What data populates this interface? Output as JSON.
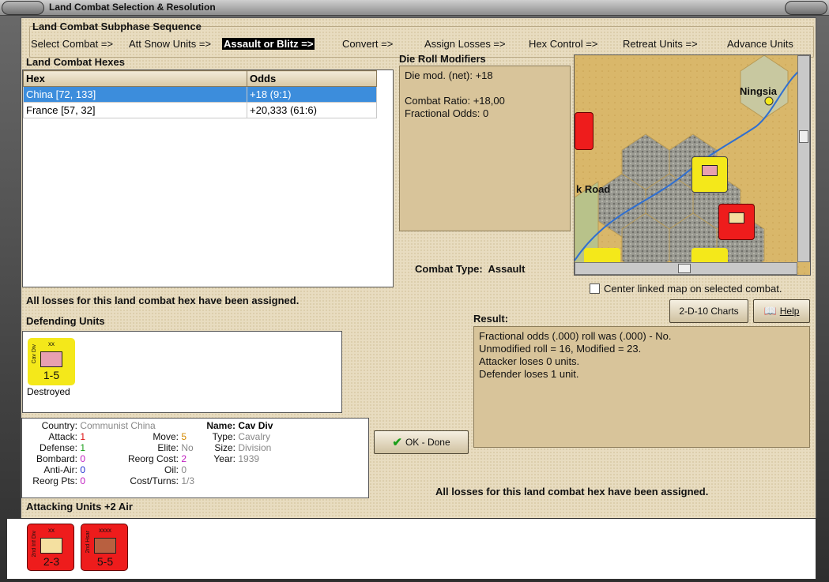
{
  "window": {
    "title": "Land Combat Selection & Resolution"
  },
  "sequence": {
    "heading": "Land Combat Subphase Sequence",
    "steps": [
      "Select Combat =>",
      "Att Snow Units =>",
      "Assault or Blitz =>",
      "Convert =>",
      "Assign Losses =>",
      "Hex Control =>",
      "Retreat Units =>",
      "Advance Units"
    ],
    "active_index": 2
  },
  "hexes": {
    "heading": "Land Combat Hexes",
    "columns": [
      "Hex",
      "Odds"
    ],
    "rows": [
      [
        "China [72, 133]",
        "+18 (9:1)"
      ],
      [
        "France [57, 32]",
        "+20,333 (61:6)"
      ]
    ],
    "selected": 0
  },
  "modifiers": {
    "heading": "Die Roll Modifiers",
    "line1": "Die mod. (net): +18",
    "line2": "Combat Ratio: +18,00",
    "line3": "Fractional Odds: 0"
  },
  "combat_type": {
    "label": "Combat Type:",
    "value": "Assault"
  },
  "map": {
    "city": "Ningsia",
    "road_label": "k Road",
    "center_checkbox": "Center linked map on selected combat.",
    "center_checked": false
  },
  "losses_note": "All losses for this land combat hex have been assigned.",
  "defending": {
    "heading": "Defending Units",
    "unit": {
      "size": "xx",
      "side": "Cav Div",
      "value": "1-5",
      "status": "Destroyed",
      "color": "#f4e81a"
    }
  },
  "details": {
    "country_label": "Country:",
    "country": "Communist China",
    "attack_label": "Attack:",
    "attack": "1",
    "defense_label": "Defense:",
    "defense": "1",
    "bombard_label": "Bombard:",
    "bombard": "0",
    "antiair_label": "Anti-Air:",
    "antiair": "0",
    "reorgpts_label": "Reorg Pts:",
    "reorgpts": "0",
    "move_label": "Move:",
    "move": "5",
    "elite_label": "Elite:",
    "elite": "No",
    "reorgcost_label": "Reorg Cost:",
    "reorgcost": "2",
    "oil_label": "Oil:",
    "oil": "0",
    "costturns_label": "Cost/Turns:",
    "costturns": "1/3",
    "name_label": "Name:",
    "name": "Cav Div",
    "type_label": "Type:",
    "type": "Cavalry",
    "size_label": "Size:",
    "size": "Division",
    "year_label": "Year:",
    "year": "1939"
  },
  "buttons": {
    "charts": "2-D-10 Charts",
    "help": "Help",
    "done": "OK - Done"
  },
  "result": {
    "heading": "Result:",
    "lines": [
      "Fractional odds (.000) roll was (.000)  - No.",
      "Unmodified roll = 16, Modified = 23.",
      "Attacker loses 0 units.",
      "Defender loses 1 unit."
    ]
  },
  "attacking": {
    "heading": "Attacking Units +2 Air",
    "units": [
      {
        "size": "xx",
        "side": "2nd Inf Div",
        "value": "2-3",
        "color": "#ee1c1c"
      },
      {
        "size": "xxxx",
        "side": "2nd Hsar",
        "value": "5-5",
        "color": "#ee1c1c"
      }
    ]
  },
  "colors": {
    "attacker": "#ee1c1c",
    "defender": "#f4e81a",
    "selection": "#3c8ddc",
    "panel_tan": "#d8c49a"
  }
}
